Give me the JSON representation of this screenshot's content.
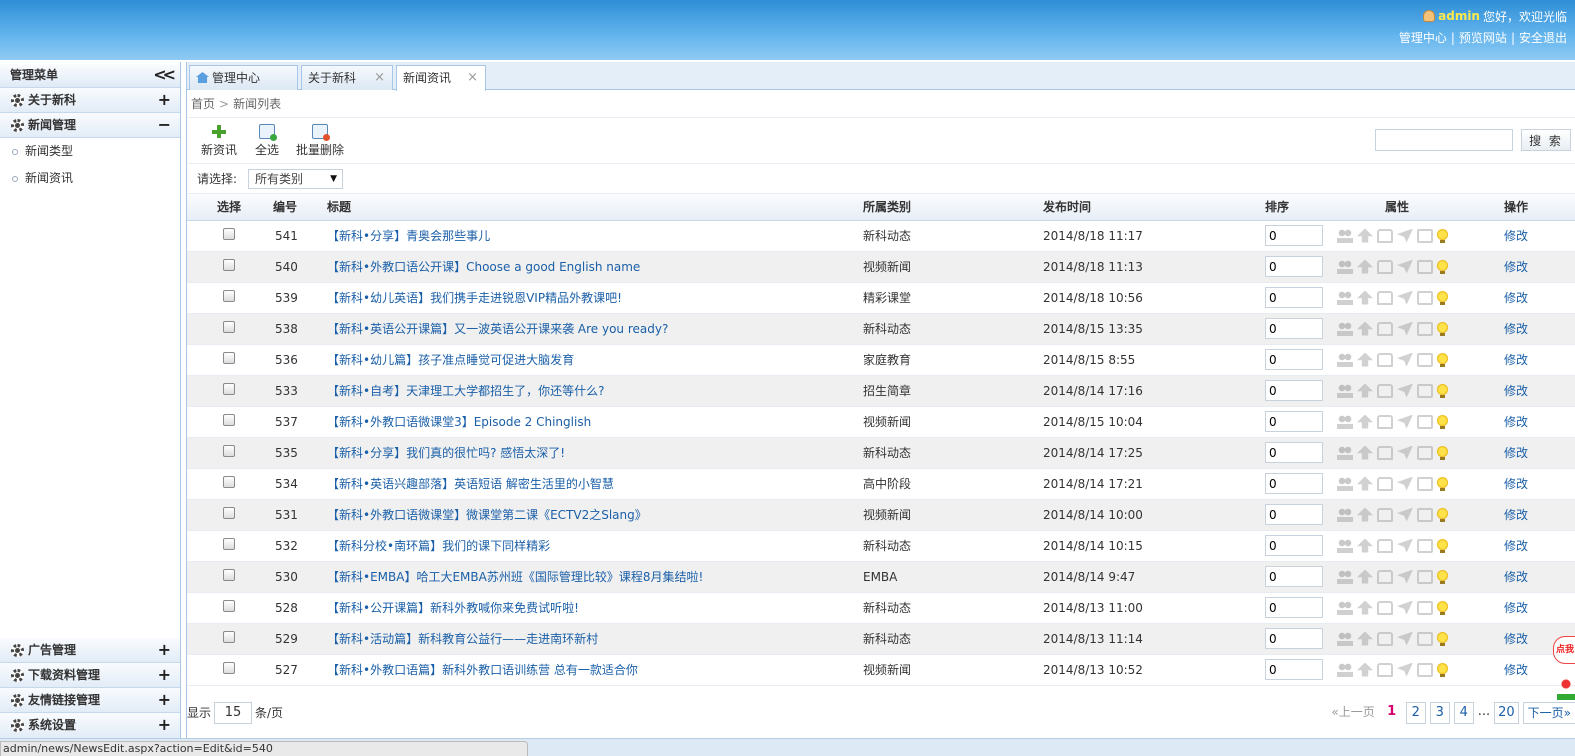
{
  "header": {
    "username": "admin",
    "welcome": "您好，欢迎光临",
    "links": [
      "管理中心",
      "预览网站",
      "安全退出"
    ]
  },
  "sidebar": {
    "title": "管理菜单",
    "groups_top": [
      {
        "label": "关于新科",
        "toggle": "+"
      },
      {
        "label": "新闻管理",
        "toggle": "−"
      }
    ],
    "sub_items": [
      "新闻类型",
      "新闻资讯"
    ],
    "groups_bottom": [
      {
        "label": "广告管理",
        "toggle": "+"
      },
      {
        "label": "下载资料管理",
        "toggle": "+"
      },
      {
        "label": "友情链接管理",
        "toggle": "+"
      },
      {
        "label": "系统设置",
        "toggle": "+"
      }
    ]
  },
  "tabs": [
    {
      "label": "管理中心",
      "closable": false
    },
    {
      "label": "关于新科",
      "closable": true
    },
    {
      "label": "新闻资讯",
      "closable": true,
      "active": true
    }
  ],
  "breadcrumb": [
    "首页",
    "新闻列表"
  ],
  "toolbar": {
    "new_label": "新资讯",
    "select_all_label": "全选",
    "batch_delete_label": "批量删除",
    "search_button": "搜 索",
    "search_value": ""
  },
  "filter": {
    "label": "请选择:",
    "selected": "所有类别"
  },
  "table": {
    "headers": [
      "选择",
      "编号",
      "标题",
      "所属类别",
      "发布时间",
      "排序",
      "属性",
      "操作"
    ],
    "rows": [
      {
        "id": "541",
        "title": "【新科•分享】青奥会那些事儿",
        "category": "新科动态",
        "time": "2014/8/18 11:17",
        "order": "0",
        "action": "修改"
      },
      {
        "id": "540",
        "title": "【新科•外教口语公开课】Choose a good English name",
        "category": "视频新闻",
        "time": "2014/8/18 11:13",
        "order": "0",
        "action": "修改"
      },
      {
        "id": "539",
        "title": "【新科•幼儿英语】我们携手走进锐恩VIP精品外教课吧!",
        "category": "精彩课堂",
        "time": "2014/8/18 10:56",
        "order": "0",
        "action": "修改"
      },
      {
        "id": "538",
        "title": "【新科•英语公开课篇】又一波英语公开课来袭 Are you ready?",
        "category": "新科动态",
        "time": "2014/8/15 13:35",
        "order": "0",
        "action": "修改"
      },
      {
        "id": "536",
        "title": "【新科•幼儿篇】孩子准点睡觉可促进大脑发育",
        "category": "家庭教育",
        "time": "2014/8/15 8:55",
        "order": "0",
        "action": "修改"
      },
      {
        "id": "533",
        "title": "【新科•自考】天津理工大学都招生了，你还等什么?",
        "category": "招生简章",
        "time": "2014/8/14 17:16",
        "order": "0",
        "action": "修改"
      },
      {
        "id": "537",
        "title": "【新科•外教口语微课堂3】Episode 2 Chinglish",
        "category": "视频新闻",
        "time": "2014/8/15 10:04",
        "order": "0",
        "action": "修改"
      },
      {
        "id": "535",
        "title": "【新科•分享】我们真的很忙吗? 感悟太深了!",
        "category": "新科动态",
        "time": "2014/8/14 17:25",
        "order": "0",
        "action": "修改"
      },
      {
        "id": "534",
        "title": "【新科•英语兴趣部落】英语短语 解密生活里的小智慧",
        "category": "高中阶段",
        "time": "2014/8/14 17:21",
        "order": "0",
        "action": "修改"
      },
      {
        "id": "531",
        "title": "【新科•外教口语微课堂】微课堂第二课《ECTV2之Slang》",
        "category": "视频新闻",
        "time": "2014/8/14 10:00",
        "order": "0",
        "action": "修改"
      },
      {
        "id": "532",
        "title": "【新科分校•南环篇】我们的课下同样精彩",
        "category": "新科动态",
        "time": "2014/8/14 10:15",
        "order": "0",
        "action": "修改"
      },
      {
        "id": "530",
        "title": "【新科•EMBA】哈工大EMBA苏州班《国际管理比较》课程8月集结啦!",
        "category": "EMBA",
        "time": "2014/8/14 9:47",
        "order": "0",
        "action": "修改"
      },
      {
        "id": "528",
        "title": "【新科•公开课篇】新科外教喊你来免费试听啦!",
        "category": "新科动态",
        "time": "2014/8/13 11:00",
        "order": "0",
        "action": "修改"
      },
      {
        "id": "529",
        "title": "【新科•活动篇】新科教育公益行——走进南环新村",
        "category": "新科动态",
        "time": "2014/8/13 11:14",
        "order": "0",
        "action": "修改"
      },
      {
        "id": "527",
        "title": "【新科•外教口语篇】新科外教口语训练营 总有一款适合你",
        "category": "视频新闻",
        "time": "2014/8/13 10:52",
        "order": "0",
        "action": "修改"
      }
    ]
  },
  "pager": {
    "show_label": "显示",
    "page_size": "15",
    "per_page_label": "条/页",
    "prev": "«上一页",
    "current": "1",
    "pages": [
      "2",
      "3",
      "4"
    ],
    "ellipsis": "...",
    "last": "20",
    "next": "下一页»"
  },
  "status_bar": {
    "text": "admin/news/NewsEdit.aspx?action=Edit&id=540"
  },
  "float_widget": {
    "text": "点我"
  }
}
